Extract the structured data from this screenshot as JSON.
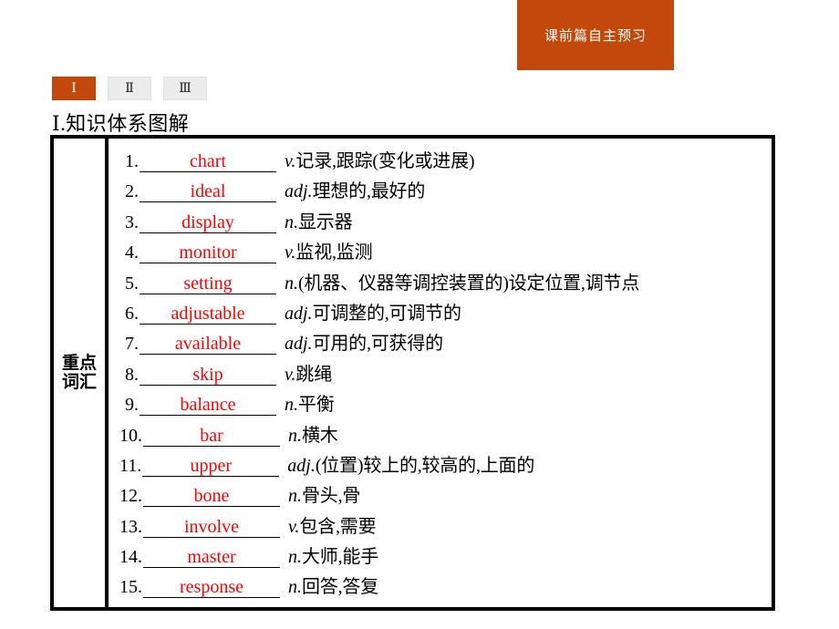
{
  "header": {
    "banner_label": "课前篇自主预习",
    "banner_color": "#c2490b"
  },
  "tabs": [
    {
      "label": "Ⅰ",
      "state": "active"
    },
    {
      "label": "Ⅱ",
      "state": "inactive"
    },
    {
      "label": "Ⅲ",
      "state": "inactive"
    }
  ],
  "section": {
    "heading": "Ⅰ.知识体系图解"
  },
  "table": {
    "row_label": "重点词汇",
    "answer_color": "#ff0000",
    "items": [
      {
        "num": "1.",
        "answer": "chart",
        "pos": "v.",
        "definition": "记录,跟踪(变化或进展)"
      },
      {
        "num": "2.",
        "answer": "ideal",
        "pos": "adj.",
        "definition": "理想的,最好的"
      },
      {
        "num": "3.",
        "answer": "display",
        "pos": "n.",
        "definition": "显示器"
      },
      {
        "num": "4.",
        "answer": "monitor",
        "pos": "v.",
        "definition": "监视,监测"
      },
      {
        "num": "5.",
        "answer": "setting",
        "pos": "n.",
        "definition": "(机器、仪器等调控装置的)设定位置,调节点"
      },
      {
        "num": "6.",
        "answer": "adjustable",
        "pos": "adj.",
        "definition": "可调整的,可调节的"
      },
      {
        "num": "7.",
        "answer": "available",
        "pos": "adj.",
        "definition": "可用的,可获得的"
      },
      {
        "num": "8.",
        "answer": "skip",
        "pos": "v.",
        "definition": "跳绳"
      },
      {
        "num": "9.",
        "answer": "balance",
        "pos": "n.",
        "definition": "平衡"
      },
      {
        "num": "10.",
        "answer": "bar",
        "pos": "n.",
        "definition": "横木"
      },
      {
        "num": "11.",
        "answer": "upper",
        "pos": "adj.",
        "definition": "(位置)较上的,较高的,上面的"
      },
      {
        "num": "12.",
        "answer": "bone",
        "pos": "n.",
        "definition": "骨头,骨"
      },
      {
        "num": "13.",
        "answer": "involve",
        "pos": "v.",
        "definition": "包含,需要"
      },
      {
        "num": "14.",
        "answer": "master",
        "pos": "n.",
        "definition": "大师,能手"
      },
      {
        "num": "15.",
        "answer": "response",
        "pos": "n.",
        "definition": "回答,答复"
      }
    ]
  }
}
